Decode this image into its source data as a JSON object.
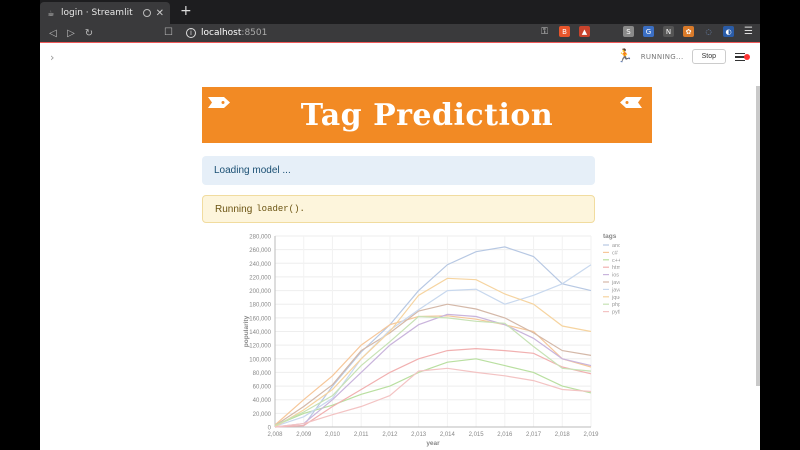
{
  "browser": {
    "tab_title": "login · Streamlit",
    "new_tab_label": "+",
    "url_host": "localhost",
    "url_port": ":8501"
  },
  "header": {
    "running_label": "RUNNING...",
    "stop_label": "Stop"
  },
  "banner": {
    "title": "Tag Prediction"
  },
  "alerts": {
    "info_text": "Loading model ...",
    "warning_prefix": "Running",
    "warning_code": "loader()."
  },
  "chart_data": {
    "type": "line",
    "xlabel": "year",
    "ylabel": "popularity",
    "legend_title": "tags",
    "legend_position": "right",
    "x": [
      "2,008",
      "2,009",
      "2,010",
      "2,011",
      "2,012",
      "2,013",
      "2,014",
      "2,015",
      "2,016",
      "2,017",
      "2,018",
      "2,019"
    ],
    "x_values": [
      2008,
      2009,
      2010,
      2011,
      2012,
      2013,
      2014,
      2015,
      2016,
      2017,
      2018,
      2019
    ],
    "ylim": [
      0,
      280000
    ],
    "yticks": [
      "0",
      "20,000",
      "40,000",
      "60,000",
      "80,000",
      "100,000",
      "120,000",
      "140,000",
      "160,000",
      "180,000",
      "200,000",
      "220,000",
      "240,000",
      "260,000",
      "280,000"
    ],
    "grid": true,
    "series": [
      {
        "name": "android",
        "color": "#b7c8e3",
        "values": [
          0,
          2000,
          60000,
          110000,
          150000,
          200000,
          238000,
          257000,
          264000,
          250000,
          210000,
          200000
        ]
      },
      {
        "name": "c#",
        "color": "#f6c79a",
        "values": [
          3000,
          40000,
          75000,
          120000,
          150000,
          162000,
          163000,
          158000,
          150000,
          140000,
          100000,
          88000
        ]
      },
      {
        "name": "c++",
        "color": "#b9dfa0",
        "values": [
          2000,
          20000,
          32000,
          48000,
          60000,
          80000,
          95000,
          100000,
          90000,
          80000,
          60000,
          50000
        ]
      },
      {
        "name": "html",
        "color": "#f1b0b0",
        "values": [
          0,
          2000,
          30000,
          55000,
          80000,
          100000,
          112000,
          115000,
          112000,
          108000,
          88000,
          78000
        ]
      },
      {
        "name": "ios",
        "color": "#c9b4dc",
        "values": [
          0,
          5000,
          40000,
          80000,
          120000,
          150000,
          165000,
          162000,
          150000,
          130000,
          100000,
          90000
        ]
      },
      {
        "name": "java",
        "color": "#d4b8a8",
        "values": [
          2000,
          30000,
          62000,
          112000,
          138000,
          170000,
          180000,
          173000,
          160000,
          138000,
          112000,
          105000
        ]
      },
      {
        "name": "javascript",
        "color": "#c8d8ee",
        "values": [
          1000,
          15000,
          42000,
          100000,
          142000,
          172000,
          200000,
          202000,
          180000,
          193000,
          210000,
          238000
        ]
      },
      {
        "name": "jquery",
        "color": "#f6d4a0",
        "values": [
          0,
          25000,
          55000,
          100000,
          140000,
          193000,
          218000,
          216000,
          195000,
          180000,
          148000,
          140000
        ]
      },
      {
        "name": "php",
        "color": "#c7e2b5",
        "values": [
          2000,
          22000,
          46000,
          90000,
          125000,
          162000,
          160000,
          155000,
          152000,
          118000,
          86000,
          82000
        ]
      },
      {
        "name": "python",
        "color": "#f3c3c3",
        "values": [
          0,
          5000,
          18000,
          30000,
          46000,
          82000,
          86000,
          80000,
          75000,
          68000,
          55000,
          52000
        ]
      }
    ]
  }
}
